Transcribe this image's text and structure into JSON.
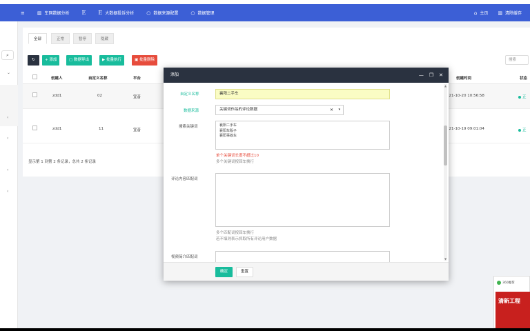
{
  "topnav": {
    "items": [
      {
        "icon": "menu-icon",
        "label": ""
      },
      {
        "icon": "bar-chart-icon",
        "label": "车网数据分析"
      },
      {
        "icon": "e-icon",
        "label": ""
      },
      {
        "icon": "e-icon",
        "label": "大数据投诉分析"
      },
      {
        "icon": "circle-icon",
        "label": "数据来源配置"
      },
      {
        "icon": "circle-icon",
        "label": "数据管理"
      }
    ],
    "right": [
      {
        "icon": "home-icon",
        "label": "主页"
      },
      {
        "icon": "trash-icon",
        "label": "清除缓存"
      }
    ]
  },
  "tabs": [
    {
      "label": "全部",
      "active": true
    },
    {
      "label": "正常",
      "active": false
    },
    {
      "label": "暂停",
      "active": false
    },
    {
      "label": "隐藏",
      "active": false
    }
  ],
  "toolbar": {
    "refresh_icon": "refresh-icon",
    "add": "+ 添加",
    "export": "▢ 数据导出",
    "run": "▶ 批量执行",
    "delete": "▣ 批量删除",
    "search_placeholder": "搜索",
    "colors": {
      "refresh": "#2a3240",
      "green": "#18bc9c",
      "red": "#e74c3c"
    }
  },
  "table": {
    "headers": {
      "creator": "创建人",
      "custom_name": "自定义名称",
      "platform": "平台",
      "created": "创建时间",
      "status": "状态"
    },
    "rows": [
      {
        "creator": "zdd1",
        "custom_name": "02",
        "platform": "宜音",
        "created": "121-10-20 10:56:58",
        "status": "正"
      },
      {
        "creator": "zdd1",
        "custom_name": "11",
        "platform": "宜音",
        "created": "121-10-19 09:01:04",
        "status": "正"
      }
    ],
    "pager": "显示第 1 到第 2 条记录，总共 2 条记录"
  },
  "modal": {
    "title": "添加",
    "controls": [
      "—",
      "❐",
      "✕"
    ],
    "fields": {
      "custom_name_label": "自定义名称",
      "custom_name_value": "襄阳二手车",
      "source_label": "数据来源",
      "source_value": "关键词作品的评论数据",
      "keywords_label": "搜索关键词",
      "keywords": [
        "襄阳二手车",
        "襄阳车贩子",
        "襄阳事故车"
      ],
      "keywords_error": "单个关键词长度不超过10",
      "keywords_hint": "多个关键词按回车换行",
      "comment_match_label": "评论内容匹配词",
      "comment_hint_1": "多个匹配词按回车换行",
      "comment_hint_2": "若不填则表示抓取所有评论用户数据",
      "video_match_label": "视频简介匹配词"
    },
    "footer": {
      "ok": "确定",
      "reset": "重置"
    },
    "accent": "#18bc9c"
  },
  "popup": {
    "brand": "360推荐",
    "ad_text": "清新工程"
  }
}
